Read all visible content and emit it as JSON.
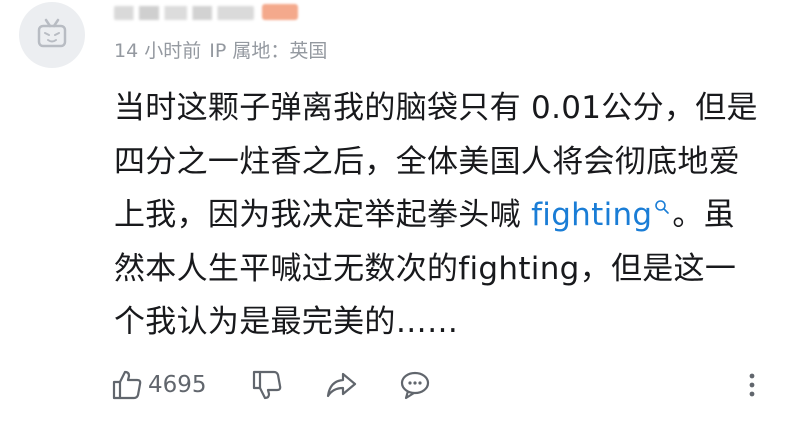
{
  "comment": {
    "meta": {
      "time": "14 小时前",
      "ip_location": "IP 属地：英国"
    },
    "content": {
      "part1": "当时这颗子弹离我的脑袋只有 0.01公分，但是四分之一炷香之后，全体美国人将会彻底地爱上我，因为我决定举起拳头喊 ",
      "link_text": "fighting",
      "part2": "。虽然本人生平喊过无数次的fighting，但是这一个我认为是最完美的……"
    },
    "actions": {
      "like_count": "4695"
    }
  },
  "icons": {
    "avatar": "default-avatar-tv-icon",
    "search": "search-icon",
    "like": "thumbs-up-icon",
    "dislike": "thumbs-down-icon",
    "share": "share-arrow-icon",
    "reply": "reply-bubble-icon",
    "more": "more-vertical-icon"
  },
  "colors": {
    "text": "#18191c",
    "meta": "#9499a0",
    "link": "#1a7dd6",
    "icon": "#61666d",
    "avatar_bg": "#eceef1"
  }
}
